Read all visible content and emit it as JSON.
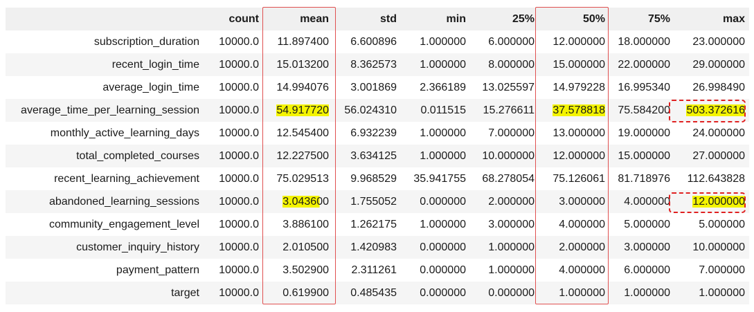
{
  "table": {
    "columns": [
      "count",
      "mean",
      "std",
      "min",
      "25%",
      "50%",
      "75%",
      "max"
    ],
    "rows": [
      {
        "name": "subscription_duration",
        "values": [
          "10000.0",
          "11.897400",
          "6.600896",
          "1.000000",
          "6.000000",
          "12.000000",
          "18.000000",
          "23.000000"
        ]
      },
      {
        "name": "recent_login_time",
        "values": [
          "10000.0",
          "15.013200",
          "8.362573",
          "1.000000",
          "8.000000",
          "15.000000",
          "22.000000",
          "29.000000"
        ]
      },
      {
        "name": "average_login_time",
        "values": [
          "10000.0",
          "14.994076",
          "3.001869",
          "2.366189",
          "13.025597",
          "14.979228",
          "16.995340",
          "26.998490"
        ]
      },
      {
        "name": "average_time_per_learning_session",
        "values": [
          "10000.0",
          "54.917720",
          "56.024310",
          "0.011515",
          "15.276611",
          "37.578818",
          "75.584200",
          "503.372616"
        ]
      },
      {
        "name": "monthly_active_learning_days",
        "values": [
          "10000.0",
          "12.545400",
          "6.932239",
          "1.000000",
          "7.000000",
          "13.000000",
          "19.000000",
          "24.000000"
        ]
      },
      {
        "name": "total_completed_courses",
        "values": [
          "10000.0",
          "12.227500",
          "3.634125",
          "1.000000",
          "10.000000",
          "12.000000",
          "15.000000",
          "27.000000"
        ]
      },
      {
        "name": "recent_learning_achievement",
        "values": [
          "10000.0",
          "75.029513",
          "9.968529",
          "35.941755",
          "68.278054",
          "75.126061",
          "81.718976",
          "112.643828"
        ]
      },
      {
        "name": "abandoned_learning_sessions",
        "values": [
          "10000.0",
          "3.043600",
          "1.755052",
          "0.000000",
          "2.000000",
          "3.000000",
          "4.000000",
          "12.000000"
        ]
      },
      {
        "name": "community_engagement_level",
        "values": [
          "10000.0",
          "3.886100",
          "1.262175",
          "1.000000",
          "3.000000",
          "4.000000",
          "5.000000",
          "5.000000"
        ]
      },
      {
        "name": "customer_inquiry_history",
        "values": [
          "10000.0",
          "2.010500",
          "1.420983",
          "0.000000",
          "1.000000",
          "2.000000",
          "3.000000",
          "10.000000"
        ]
      },
      {
        "name": "payment_pattern",
        "values": [
          "10000.0",
          "3.502900",
          "2.311261",
          "0.000000",
          "1.000000",
          "4.000000",
          "6.000000",
          "7.000000"
        ]
      },
      {
        "name": "target",
        "values": [
          "10000.0",
          "0.619900",
          "0.485435",
          "0.000000",
          "0.000000",
          "1.000000",
          "1.000000",
          "1.000000"
        ]
      }
    ]
  },
  "annotations": {
    "highlight_color": "#f4f400",
    "outline_color": "#e05050",
    "dashed_color": "#e02020"
  }
}
